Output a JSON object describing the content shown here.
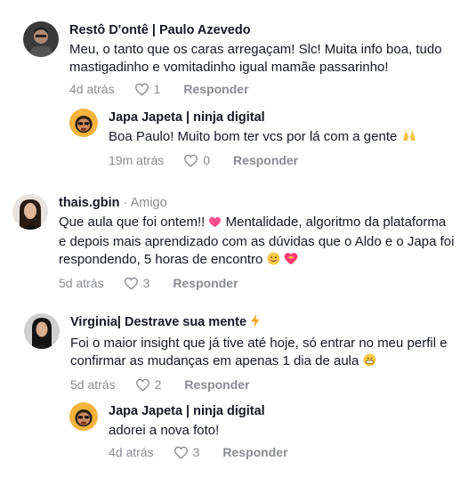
{
  "comments": [
    {
      "author": "Restô D'ontê | Paulo Azevedo",
      "text": "Meu, o tanto que os caras arregaçam! Slc! Muita info boa, tudo mastigadinho e vomitadinho igual mamãe passarinho!",
      "time": "4d atrás",
      "likes": "1",
      "reply_label": "Responder",
      "reply": {
        "author": "Japa Japeta | ninja digital",
        "text": "Boa Paulo! Muito bom ter vcs por lá com a gente",
        "emoji": "raising-hands",
        "time": "19m atrás",
        "likes": "0",
        "reply_label": "Responder"
      }
    },
    {
      "author": "thais.gbin",
      "tag": " · Amigo",
      "text_part1": "Que aula que foi ontem!!",
      "text_part2": " Mentalidade, algoritmo da plataforma e depois mais aprendizado com as dúvidas que o Aldo e o Japa foi respondendo, 5 horas de encontro",
      "time": "5d atrás",
      "likes": "3",
      "reply_label": "Responder"
    },
    {
      "author": "Virginia| Destrave sua mente",
      "text": "Foi o maior insight que já tive até hoje, só entrar no meu perfil e confirmar as mudanças em apenas 1 dia de aula",
      "time": "5d atrás",
      "likes": "2",
      "reply_label": "Responder",
      "reply": {
        "author": "Japa Japeta | ninja digital",
        "text": "adorei a nova foto!",
        "time": "4d atrás",
        "likes": "3",
        "reply_label": "Responder"
      }
    }
  ],
  "colors": {
    "text": "#161823",
    "muted": "#8a8b91",
    "heart_pink": "#ff4d8d"
  }
}
